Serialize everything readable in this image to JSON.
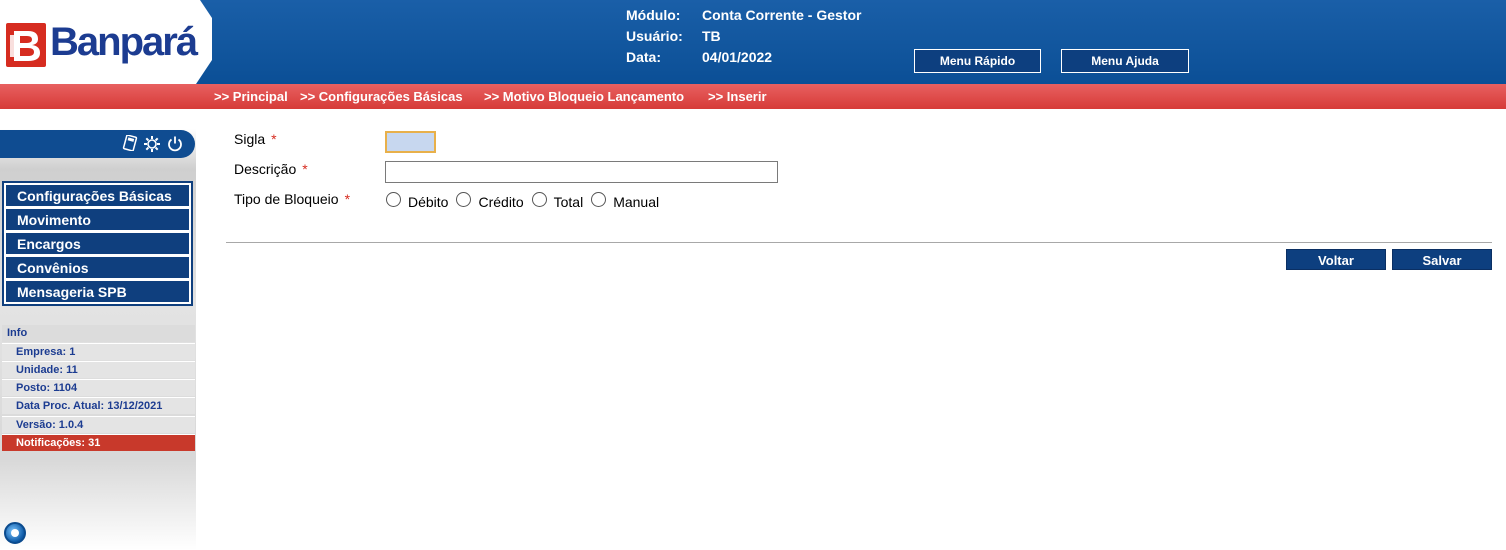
{
  "brand": {
    "name": "Banpará",
    "accent": "#0f3f7e",
    "red": "#d62c20"
  },
  "header": {
    "modulo_label": "Módulo:",
    "modulo_value": "Conta Corrente - Gestor",
    "usuario_label": "Usuário:",
    "usuario_value": "TB",
    "data_label": "Data:",
    "data_value": "04/01/2022",
    "menu_rapido": "Menu Rápido",
    "menu_ajuda": "Menu Ajuda"
  },
  "breadcrumb": {
    "items": [
      ">> Principal",
      ">> Configurações Básicas",
      ">> Motivo Bloqueio Lançamento",
      ">> Inserir"
    ]
  },
  "sidebar": {
    "tools": [
      "calculator-icon",
      "settings-icon",
      "power-icon"
    ],
    "menu": [
      "Configurações Básicas",
      "Movimento",
      "Encargos",
      "Convênios",
      "Mensageria SPB"
    ],
    "info_title": "Info",
    "info": [
      "Empresa: 1",
      "Unidade: 11",
      "Posto: 1104",
      "Data Proc. Atual: 13/12/2021",
      "Versão: 1.0.4"
    ],
    "notifications": "Notificações: 31"
  },
  "form": {
    "sigla_label": "Sigla",
    "sigla_value": "",
    "descricao_label": "Descrição",
    "descricao_value": "",
    "tipo_label": "Tipo de Bloqueio",
    "required_mark": "*",
    "tipo_options": [
      "Débito",
      "Crédito",
      "Total",
      "Manual"
    ]
  },
  "actions": {
    "voltar": "Voltar",
    "salvar": "Salvar"
  }
}
